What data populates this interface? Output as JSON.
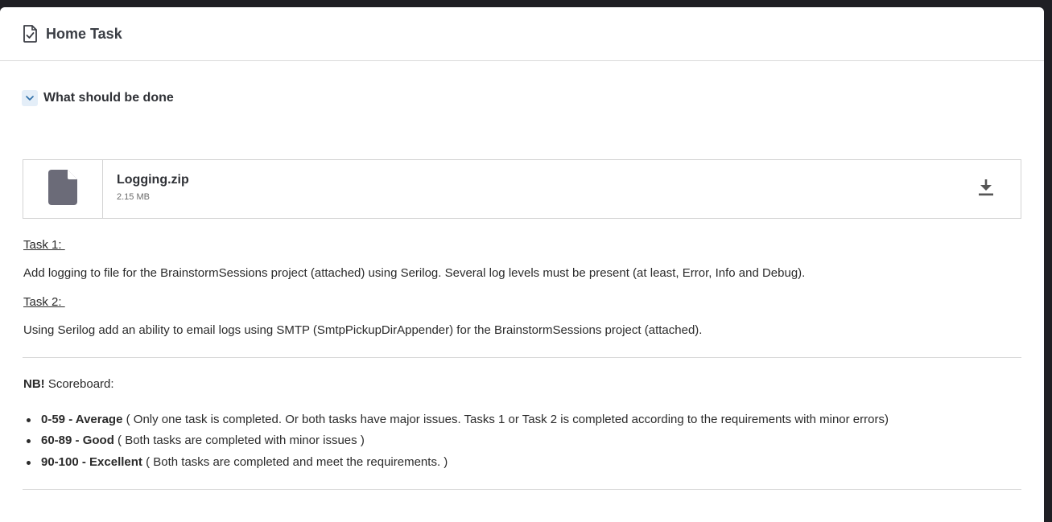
{
  "header": {
    "title": "Home Task",
    "icon": "document-check-icon"
  },
  "section": {
    "toggle_label": "What should be done",
    "icon": "chevron-down-icon"
  },
  "attachment": {
    "file_name": "Logging.zip",
    "file_size": "2.15 MB",
    "file_icon": "file-icon",
    "download_icon": "download-icon"
  },
  "tasks": [
    {
      "label": "Task 1: ",
      "text": "Add logging to file for the BrainstormSessions project (attached) using Serilog. Several log levels must be present (at least, Error, Info and Debug)."
    },
    {
      "label": "Task 2: ",
      "text": "Using Serilog add an ability to email logs using SMTP (SmtpPickupDirAppender) for the BrainstormSessions project (attached)."
    }
  ],
  "scoreboard": {
    "nb": "NB!",
    "label": " Scoreboard:",
    "items": [
      {
        "range": "0-59 - ",
        "grade": "Average",
        "desc": " ( Only one task is completed. Or both tasks have major issues. Tasks 1 or Task 2 is completed according to the requirements with minor errors)"
      },
      {
        "range": "60-89 - ",
        "grade": "Good",
        "desc": " ( Both tasks are completed with minor issues )"
      },
      {
        "range": "90-100 - ",
        "grade": "Excellent",
        "desc": " ( Both tasks are completed and meet the requirements. )"
      }
    ]
  },
  "colors": {
    "page_bg": "#1f1f24",
    "card_bg": "#ffffff",
    "accent_light": "#e4eef8",
    "accent": "#2f6ea8",
    "file_icon": "#6b6b78"
  }
}
